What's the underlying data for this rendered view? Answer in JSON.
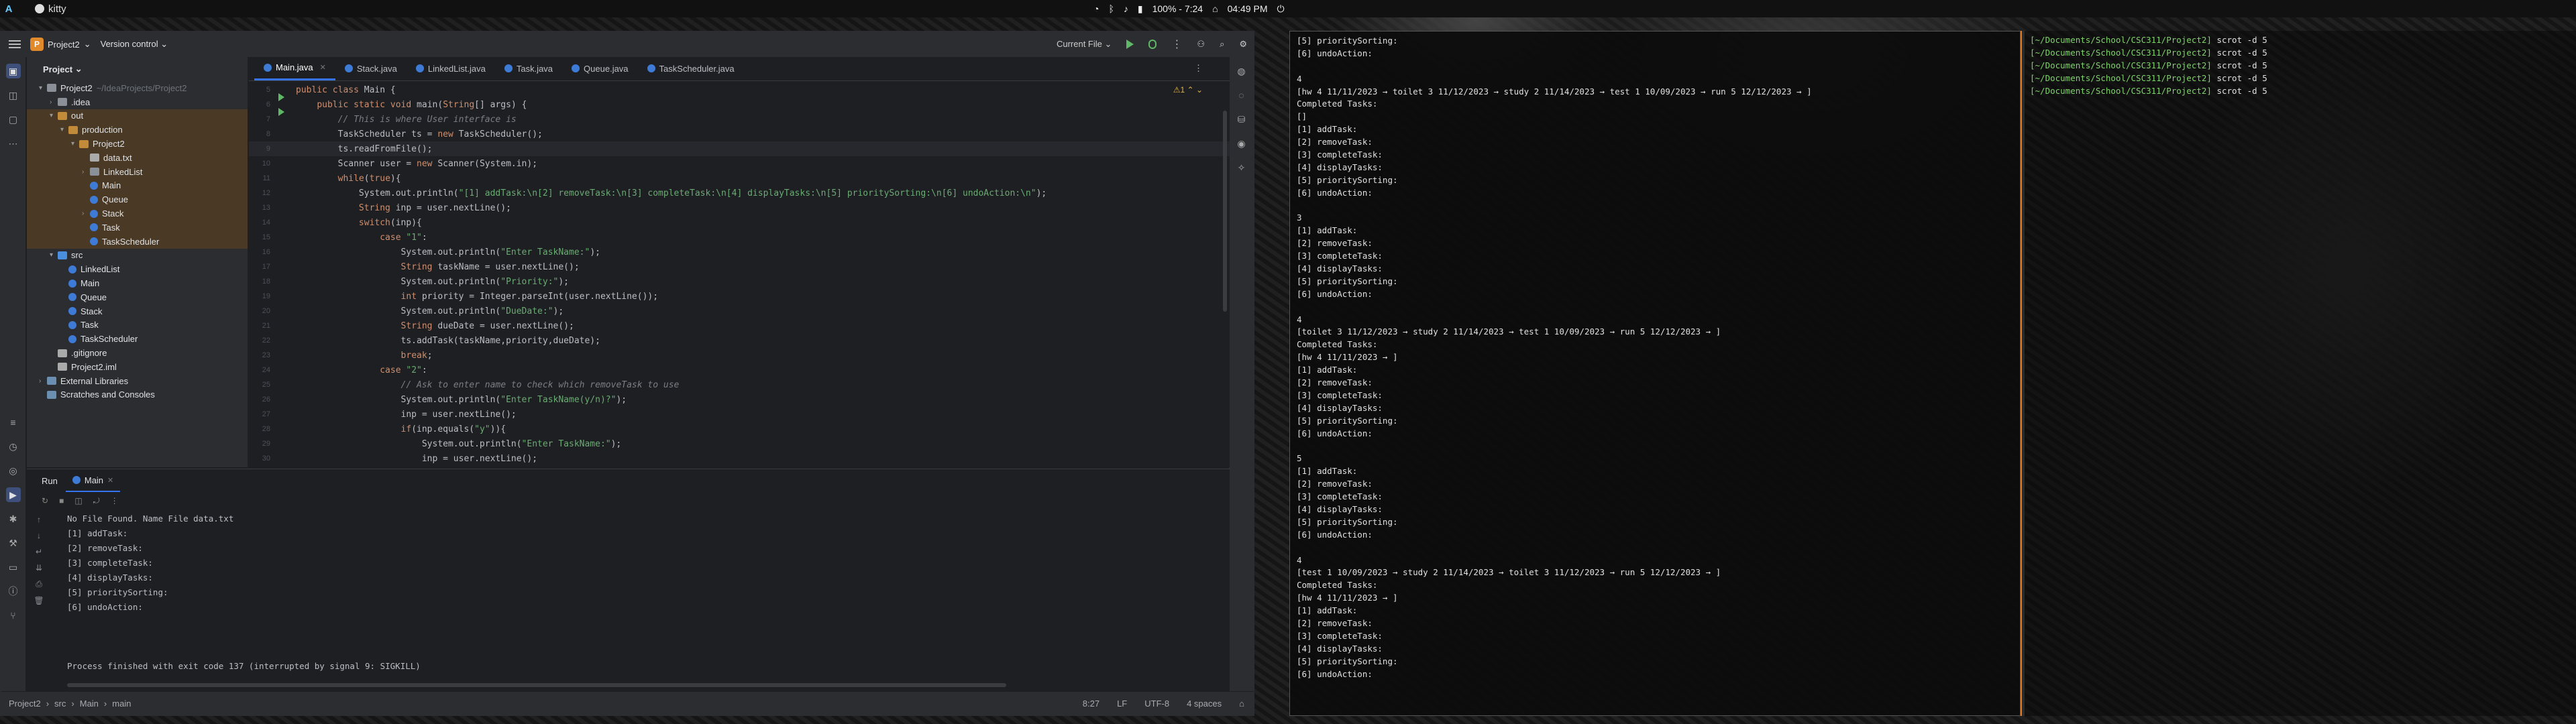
{
  "topbar": {
    "workspace": "A",
    "window_title": "kitty",
    "battery": "100% - 7:24",
    "clock": "04:49 PM"
  },
  "ide": {
    "project_name": "Project2",
    "project_initial": "P",
    "vcs_label": "Version control",
    "run_config": "Current File",
    "panel_title": "Project",
    "tree": [
      {
        "label": "Project2",
        "extra": "~/IdeaProjects/Project2",
        "depth": 0,
        "kind": "folder",
        "arrow": "▾"
      },
      {
        "label": ".idea",
        "depth": 1,
        "kind": "folder",
        "arrow": "›"
      },
      {
        "label": "out",
        "depth": 1,
        "kind": "out",
        "arrow": "▾"
      },
      {
        "label": "production",
        "depth": 2,
        "kind": "out",
        "arrow": "▾"
      },
      {
        "label": "Project2",
        "depth": 3,
        "kind": "out",
        "arrow": "▾",
        "selected": true
      },
      {
        "label": "data.txt",
        "depth": 4,
        "kind": "file",
        "arrow": ""
      },
      {
        "label": "LinkedList",
        "depth": 4,
        "kind": "folder",
        "arrow": "›"
      },
      {
        "label": "Main",
        "depth": 4,
        "kind": "cls",
        "arrow": ""
      },
      {
        "label": "Queue",
        "depth": 4,
        "kind": "cls",
        "arrow": ""
      },
      {
        "label": "Stack",
        "depth": 4,
        "kind": "cls",
        "arrow": "›"
      },
      {
        "label": "Task",
        "depth": 4,
        "kind": "cls",
        "arrow": ""
      },
      {
        "label": "TaskScheduler",
        "depth": 4,
        "kind": "cls",
        "arrow": ""
      },
      {
        "label": "src",
        "depth": 1,
        "kind": "src",
        "arrow": "▾"
      },
      {
        "label": "LinkedList",
        "depth": 2,
        "kind": "cls",
        "arrow": ""
      },
      {
        "label": "Main",
        "depth": 2,
        "kind": "cls",
        "arrow": ""
      },
      {
        "label": "Queue",
        "depth": 2,
        "kind": "cls",
        "arrow": ""
      },
      {
        "label": "Stack",
        "depth": 2,
        "kind": "cls",
        "arrow": ""
      },
      {
        "label": "Task",
        "depth": 2,
        "kind": "cls",
        "arrow": ""
      },
      {
        "label": "TaskScheduler",
        "depth": 2,
        "kind": "cls",
        "arrow": ""
      },
      {
        "label": ".gitignore",
        "depth": 1,
        "kind": "file",
        "arrow": ""
      },
      {
        "label": "Project2.iml",
        "depth": 1,
        "kind": "file",
        "arrow": ""
      },
      {
        "label": "External Libraries",
        "depth": 0,
        "kind": "ext",
        "arrow": "›"
      },
      {
        "label": "Scratches and Consoles",
        "depth": 0,
        "kind": "ext",
        "arrow": ""
      }
    ],
    "tabs": [
      {
        "label": "Main.java",
        "active": true
      },
      {
        "label": "Stack.java"
      },
      {
        "label": "LinkedList.java"
      },
      {
        "label": "Task.java"
      },
      {
        "label": "Queue.java"
      },
      {
        "label": "TaskScheduler.java"
      }
    ],
    "warnings": "⚠1",
    "code": [
      {
        "n": "5",
        "t": "public class Main {",
        "run": true
      },
      {
        "n": "6",
        "t": "    public static void main(String[] args) {",
        "run": true
      },
      {
        "n": "7",
        "t": "        // This is where User interface is"
      },
      {
        "n": "8",
        "t": "        TaskScheduler ts = new TaskScheduler();"
      },
      {
        "n": "9",
        "t": "        ts.readFromFile();",
        "cur": true
      },
      {
        "n": "10",
        "t": "        Scanner user = new Scanner(System.in);"
      },
      {
        "n": "11",
        "t": "        while(true){"
      },
      {
        "n": "12",
        "t": "            System.out.println(\"[1] addTask:\\n[2] removeTask:\\n[3] completeTask:\\n[4] displayTasks:\\n[5] prioritySorting:\\n[6] undoAction:\\n\");"
      },
      {
        "n": "13",
        "t": "            String inp = user.nextLine();"
      },
      {
        "n": "14",
        "t": "            switch(inp){"
      },
      {
        "n": "15",
        "t": "                case \"1\":"
      },
      {
        "n": "16",
        "t": "                    System.out.println(\"Enter TaskName:\");"
      },
      {
        "n": "17",
        "t": "                    String taskName = user.nextLine();"
      },
      {
        "n": "18",
        "t": "                    System.out.println(\"Priority:\");"
      },
      {
        "n": "19",
        "t": "                    int priority = Integer.parseInt(user.nextLine());"
      },
      {
        "n": "20",
        "t": "                    System.out.println(\"DueDate:\");"
      },
      {
        "n": "21",
        "t": "                    String dueDate = user.nextLine();"
      },
      {
        "n": "22",
        "t": "                    ts.addTask(taskName,priority,dueDate);"
      },
      {
        "n": "23",
        "t": "                    break;"
      },
      {
        "n": "24",
        "t": "                case \"2\":"
      },
      {
        "n": "25",
        "t": "                    // Ask to enter name to check which removeTask to use"
      },
      {
        "n": "26",
        "t": "                    System.out.println(\"Enter TaskName(y/n)?\");"
      },
      {
        "n": "27",
        "t": "                    inp = user.nextLine();"
      },
      {
        "n": "28",
        "t": "                    if(inp.equals(\"y\")){"
      },
      {
        "n": "29",
        "t": "                        System.out.println(\"Enter TaskName:\");"
      },
      {
        "n": "30",
        "t": "                        inp = user.nextLine();"
      }
    ],
    "run_label": "Run",
    "run_tab": "Main",
    "console": [
      "No File Found. Name File data.txt",
      "[1] addTask:",
      "[2] removeTask:",
      "[3] completeTask:",
      "[4] displayTasks:",
      "[5] prioritySorting:",
      "[6] undoAction:",
      "",
      "",
      "",
      "Process finished with exit code 137 (interrupted by signal 9: SIGKILL)"
    ],
    "status": {
      "crumbs": [
        "Project2",
        "src",
        "Main",
        "main"
      ],
      "position": "8:27",
      "line_sep": "LF",
      "encoding": "UTF-8",
      "indent": "4 spaces"
    }
  },
  "terminal": {
    "lines": [
      "[5] prioritySorting:",
      "[6] undoAction:",
      "",
      "4",
      "[hw 4 11/11/2023 → toilet 3 11/12/2023 → study 2 11/14/2023 → test 1 10/09/2023 → run 5 12/12/2023 → ]",
      "Completed Tasks:",
      "[]",
      "[1] addTask:",
      "[2] removeTask:",
      "[3] completeTask:",
      "[4] displayTasks:",
      "[5] prioritySorting:",
      "[6] undoAction:",
      "",
      "3",
      "[1] addTask:",
      "[2] removeTask:",
      "[3] completeTask:",
      "[4] displayTasks:",
      "[5] prioritySorting:",
      "[6] undoAction:",
      "",
      "4",
      "[toilet 3 11/12/2023 → study 2 11/14/2023 → test 1 10/09/2023 → run 5 12/12/2023 → ]",
      "Completed Tasks:",
      "[hw 4 11/11/2023 → ]",
      "[1] addTask:",
      "[2] removeTask:",
      "[3] completeTask:",
      "[4] displayTasks:",
      "[5] prioritySorting:",
      "[6] undoAction:",
      "",
      "5",
      "[1] addTask:",
      "[2] removeTask:",
      "[3] completeTask:",
      "[4] displayTasks:",
      "[5] prioritySorting:",
      "[6] undoAction:",
      "",
      "4",
      "[test 1 10/09/2023 → study 2 11/14/2023 → toilet 3 11/12/2023 → run 5 12/12/2023 → ]",
      "Completed Tasks:",
      "[hw 4 11/11/2023 → ]",
      "[1] addTask:",
      "[2] removeTask:",
      "[3] completeTask:",
      "[4] displayTasks:",
      "[5] prioritySorting:",
      "[6] undoAction:"
    ]
  },
  "shell": {
    "prompts": [
      {
        "path": "[~/Documents/School/CSC311/Project2]",
        "cmd": "scrot -d 5"
      },
      {
        "path": "[~/Documents/School/CSC311/Project2]",
        "cmd": "scrot -d 5"
      },
      {
        "path": "[~/Documents/School/CSC311/Project2]",
        "cmd": "scrot -d 5"
      },
      {
        "path": "[~/Documents/School/CSC311/Project2]",
        "cmd": "scrot -d 5"
      },
      {
        "path": "[~/Documents/School/CSC311/Project2]",
        "cmd": "scrot -d 5"
      }
    ]
  }
}
